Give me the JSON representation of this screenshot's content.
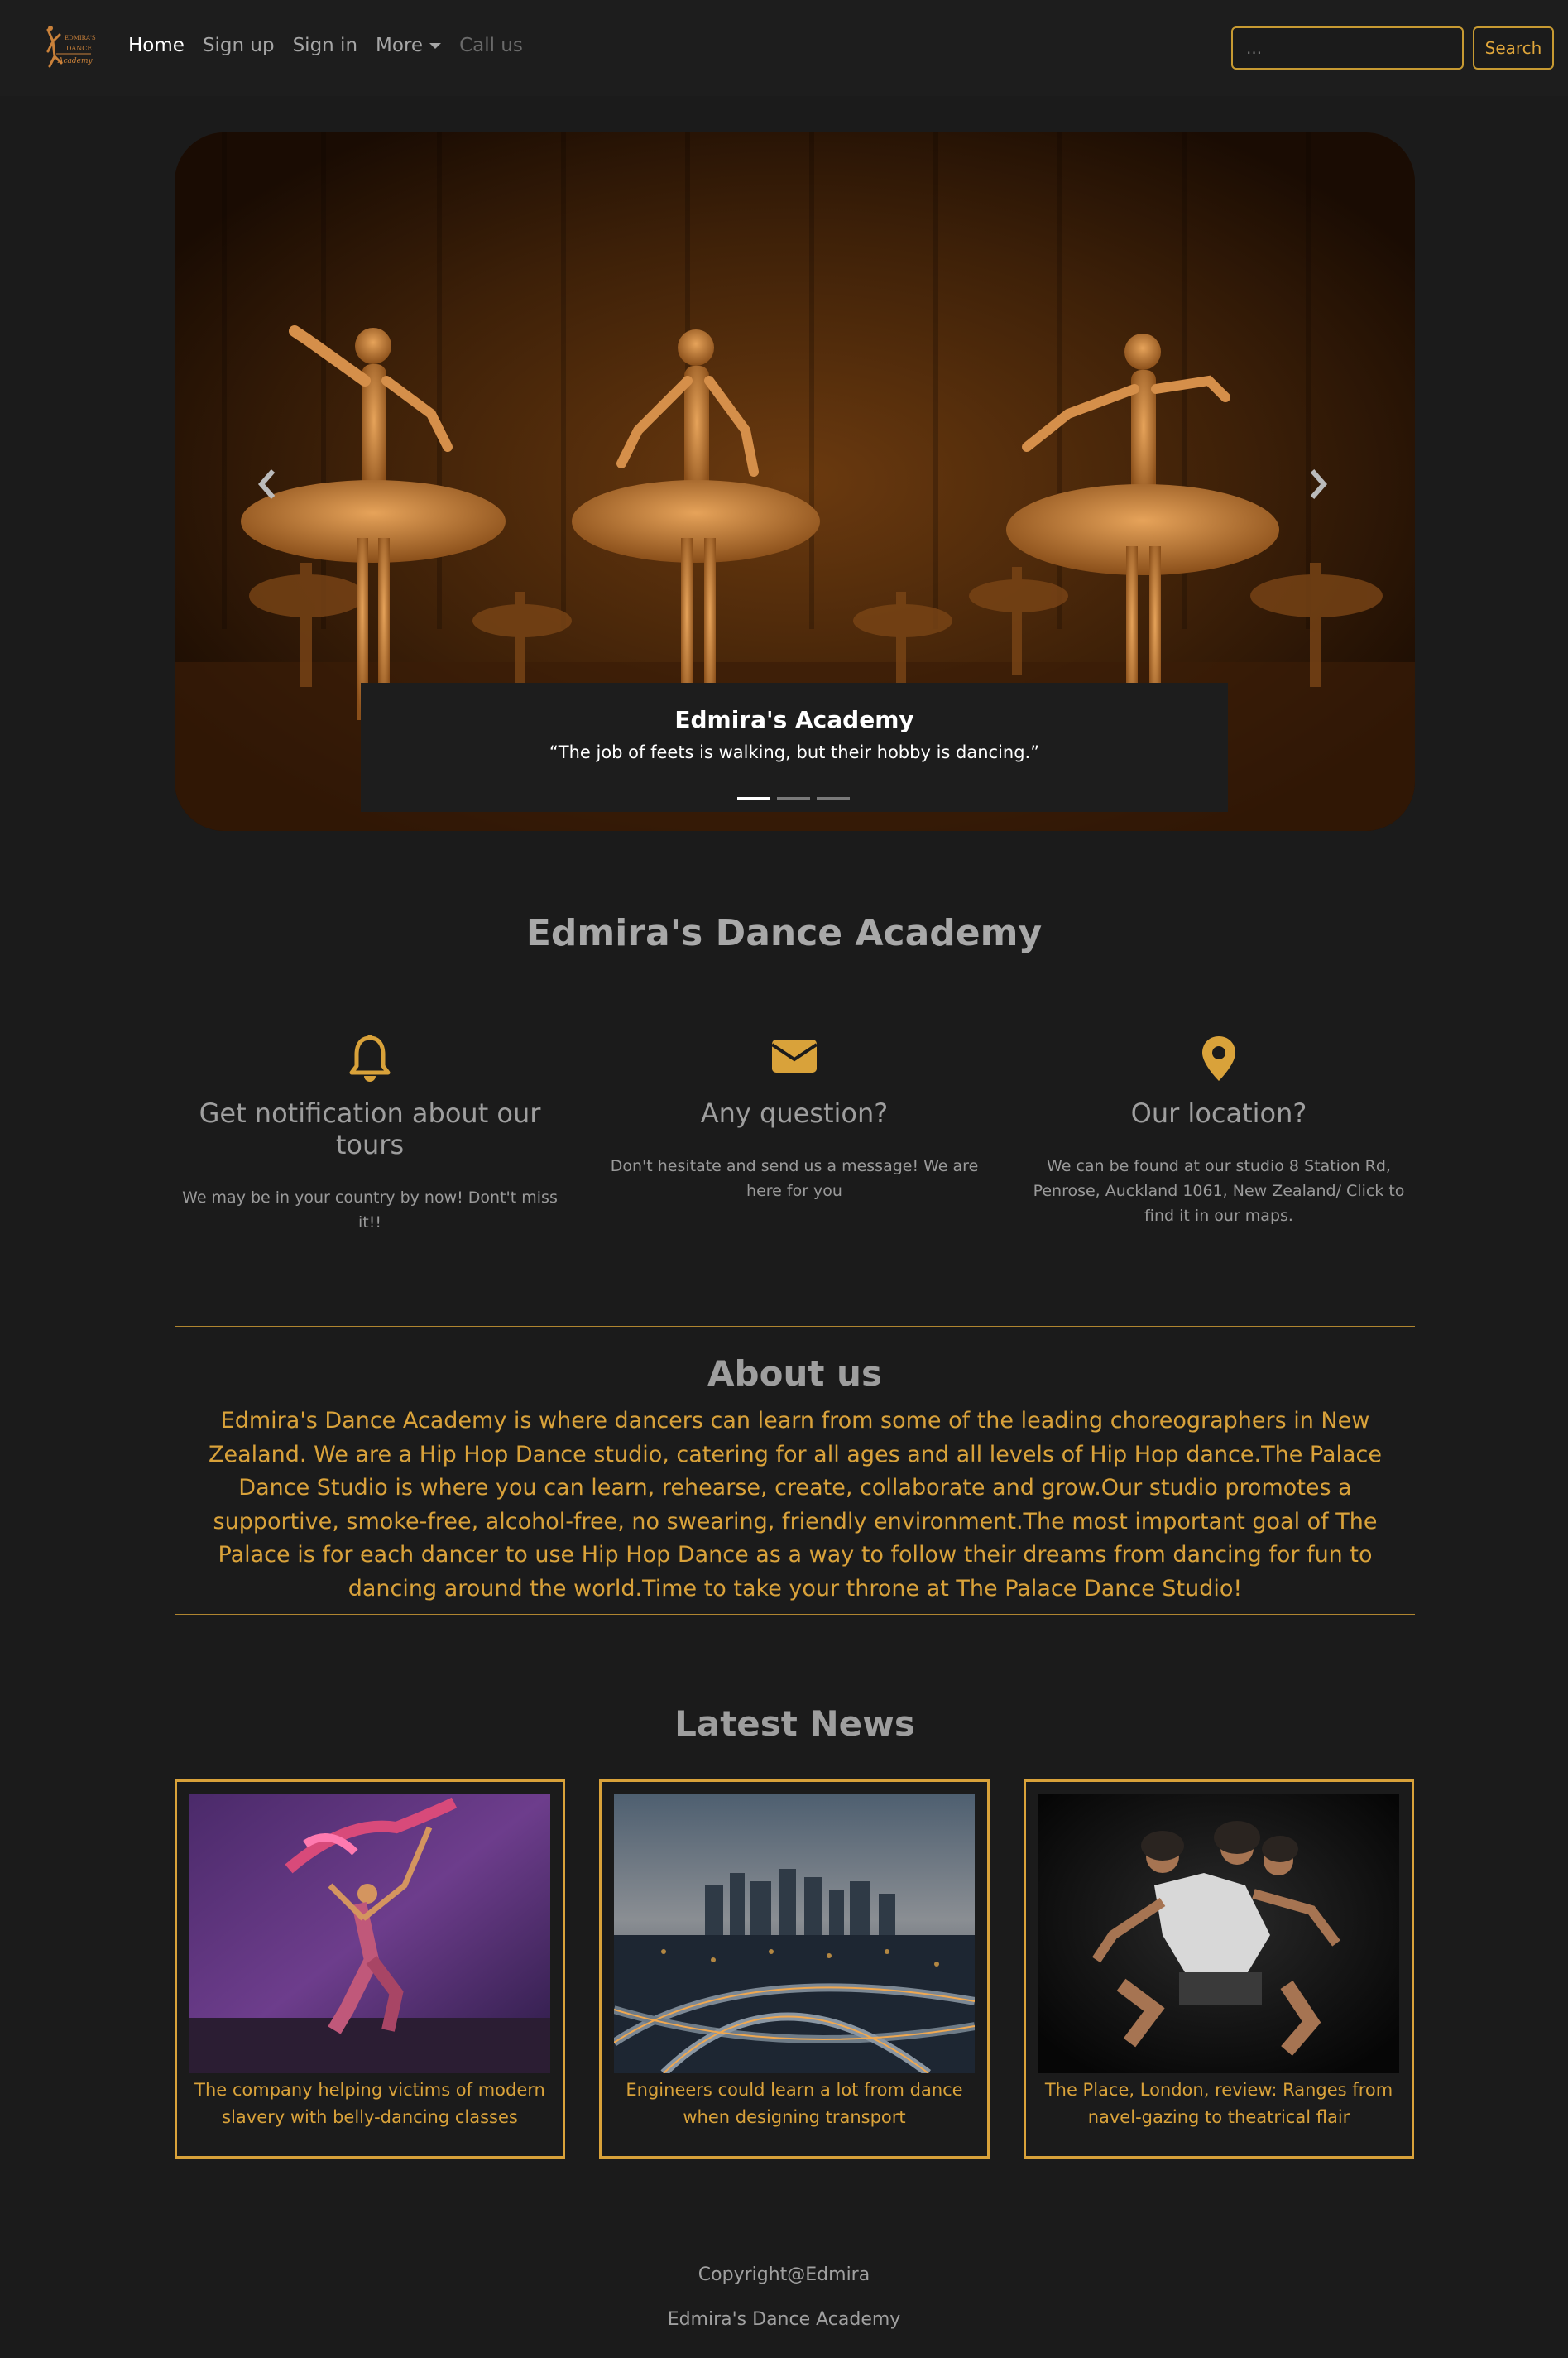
{
  "navbar": {
    "logo_text": "EDMIRA'S DANCE Academy",
    "links": [
      {
        "label": "Home",
        "state": "active"
      },
      {
        "label": "Sign up",
        "state": "normal"
      },
      {
        "label": "Sign in",
        "state": "normal"
      },
      {
        "label": "More",
        "state": "dropdown"
      },
      {
        "label": "Call us",
        "state": "disabled"
      }
    ],
    "search": {
      "placeholder": "...",
      "button_label": "Search"
    }
  },
  "carousel": {
    "caption_title": "Edmira's Academy",
    "caption_text": "“The job of feets is walking, but their hobby is dancing.”",
    "slide_count": 3,
    "active_slide": 1,
    "prev_icon": "chevron-left-icon",
    "next_icon": "chevron-right-icon"
  },
  "site_title": "Edmira's Dance Academy",
  "features": [
    {
      "icon": "bell-icon",
      "title": "Get notification about our tours",
      "text": "We may be in your country by now! Dont't miss it!!"
    },
    {
      "icon": "envelope-icon",
      "title": "Any question?",
      "text": "Don't hesitate and send us a message! We are here for you"
    },
    {
      "icon": "map-marker-icon",
      "title": "Our location?",
      "text": "We can be found at our studio 8 Station Rd, Penrose, Auckland 1061, New Zealand/ Click to find it in our maps."
    }
  ],
  "about": {
    "title": "About us",
    "text": "Edmira's Dance Academy is where dancers can learn from some of the leading choreographers in New Zealand. We are a Hip Hop Dance studio, catering for all ages and all levels of Hip Hop dance.The Palace Dance Studio is where you can learn, rehearse, create, collaborate and grow.Our studio promotes a supportive, smoke-free, alcohol-free, no swearing, friendly environment.The most important goal of The Palace is for each dancer to use Hip Hop Dance as a way to follow their dreams from dancing for fun to dancing around the world.Time to take your throne at The Palace Dance Studio!"
  },
  "news": {
    "title": "Latest News",
    "items": [
      {
        "caption": "The company helping victims of modern slavery with belly-dancing classes"
      },
      {
        "caption": "Engineers could learn a lot from dance when designing transport"
      },
      {
        "caption": "The Place, London, review: Ranges from navel-gazing to theatrical flair"
      }
    ]
  },
  "footer": {
    "copyright": "Copyright@Edmira",
    "name": "Edmira's Dance Academy"
  },
  "colors": {
    "background": "#1b1b1b",
    "accent": "#d9a23a",
    "text_muted": "#9e9e9e"
  }
}
